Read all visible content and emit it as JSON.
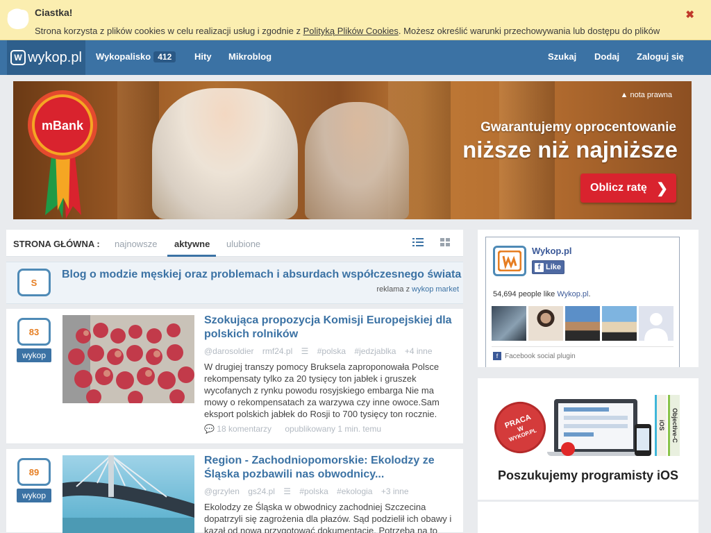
{
  "cookie": {
    "title": "Ciastka!",
    "text_before": "Strona korzysta z plików cookies w celu realizacji usług i zgodnie z ",
    "link": "Polityką Plików Cookies",
    "text_after": ". Możesz określić warunki przechowywania lub dostępu do plików",
    "close": "✖"
  },
  "nav": {
    "logo": "wykop.pl",
    "logo_mark": "W",
    "items": [
      {
        "label": "Wykopalisko",
        "badge": "412"
      },
      {
        "label": "Hity"
      },
      {
        "label": "Mikroblog"
      }
    ],
    "right": [
      "Szukaj",
      "Dodaj",
      "Zaloguj się"
    ]
  },
  "banner": {
    "brand": "mBank",
    "nota": "nota prawna",
    "headline1": "Gwarantujemy oprocentowanie",
    "headline2": "niższe niż najniższe",
    "cta": "Oblicz ratę",
    "cta_arrow": "❯"
  },
  "tabs": {
    "label": "STRONA GŁÓWNA :",
    "items": [
      "najnowsze",
      "aktywne",
      "ulubione"
    ],
    "active": "aktywne"
  },
  "promo": {
    "vote": "S",
    "title": "Blog o modzie męskiej oraz problemach i absurdach współczesnego świata",
    "ad_prefix": "reklama z ",
    "ad_link": "wykop market"
  },
  "entries": [
    {
      "votes": "83",
      "vote_btn": "wykop",
      "title": "Szokująca propozycja Komisji Europejskiej dla polskich rolników",
      "author": "@darosoldier",
      "source": "rmf24.pl",
      "tags": [
        "#polska",
        "#jedzjablka"
      ],
      "more": "+4 inne",
      "desc": "W drugiej transzy pomocy Bruksela zaproponowała Polsce rekompensaty tylko za 20 tysięcy ton jabłek i gruszek wycofanych z rynku powodu rosyjskiego embarga Nie ma mowy o rekompensatach za warzywa czy inne owoce.Sam eksport polskich jabłek do Rosji to 700 tysięcy ton rocznie.",
      "comments": "18 komentarzy",
      "published": "opublikowany 1 min. temu"
    },
    {
      "votes": "89",
      "vote_btn": "wykop",
      "title": "Region - Zachodniopomorskie: Ekolodzy ze Śląska pozbawili nas obwodnicy...",
      "author": "@grzylen",
      "source": "gs24.pl",
      "tags": [
        "#polska",
        "#ekologia"
      ],
      "more": "+3 inne",
      "desc": "Ekolodzy ze Śląska w obwodnicy zachodniej Szczecina dopatrzyli się zagrożenia dla płazów. Sąd podzielił ich obawy i kazał od nowa przygotować dokumentację. Potrzeba na to",
      "comments": "",
      "published": ""
    }
  ],
  "facebook": {
    "name": "Wykop.pl",
    "like": "Like",
    "count_prefix": "54,694 people like ",
    "count_link": "Wykop.pl",
    "count_suffix": ".",
    "plugin": "Facebook social plugin"
  },
  "ios_ad": {
    "stamp_line1": "PRACA",
    "stamp_line2": "W",
    "stamp_line3": "WYKOP.PL",
    "book1": "iOS",
    "book2": "Objective-C",
    "caption": "Poszukujemy programisty iOS"
  },
  "colors": {
    "nav": "#3b72a4",
    "link": "#3b72a4",
    "cookie_bg": "#fbeeb0",
    "vote_orange": "#e67e22"
  }
}
